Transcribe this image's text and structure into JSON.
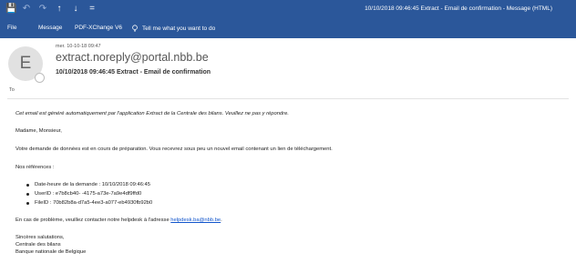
{
  "app": {
    "window_title": "10/10/2018 09:46:45 Extract - Email de confirmation  -  Message (HTML)",
    "quick_access": [
      {
        "icon": "save-icon"
      },
      {
        "icon": "undo-icon"
      },
      {
        "icon": "redo-icon"
      },
      {
        "icon": "up-arrow-icon"
      },
      {
        "icon": "down-arrow-icon"
      },
      {
        "icon": "customize-icon"
      }
    ],
    "accent_color": "#2b579a"
  },
  "ribbon": {
    "tabs": [
      "File",
      "Message",
      "PDF-XChange V6"
    ],
    "tell_me": "Tell me what you want to do"
  },
  "header": {
    "avatar_initial": "E",
    "date": "mer. 10-10-18 09:47",
    "sender": "extract.noreply@portal.nbb.be",
    "subject": "10/10/2018 09:46:45 Extract - Email de confirmation",
    "to_label": "To"
  },
  "body": {
    "notice": "Cet email est généré automatiquement par l'application Extract de la Centrale des bilans. Veuillez ne pas y répondre.",
    "greeting": "Madame, Monsieur,",
    "paragraph": "Votre demande de données est en cours de préparation. Vous recevrez sous peu un nouvel email contenant un lien de téléchargement.",
    "refs_title": "Nos références :",
    "refs": [
      "Date-heure de la demande : 10/10/2018 09:46:45",
      "UserID : e7b8cb40-        -4175-a73e-7a9e4df9ffd0",
      "FileID : 70b82b8a-d7a5-4ee3-a077-eb4930fb92b0"
    ],
    "helpdesk_prefix": "En cas de problème, veuillez contacter notre helpdesk à l'adresse ",
    "helpdesk_link": "helpdesk.ba@nbb.be",
    "helpdesk_suffix": ".",
    "closing": "Sincères salutations,",
    "signature": [
      "Centrale des bilans",
      "Banque nationale de Belgique"
    ]
  }
}
